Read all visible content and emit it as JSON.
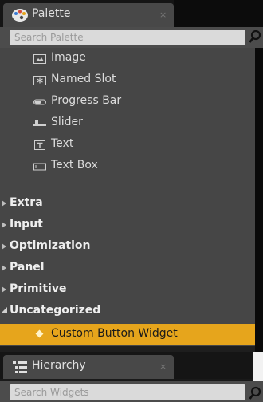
{
  "palette_tab": {
    "title": "Palette",
    "close_glyph": "×",
    "icon": "paint-palette-icon"
  },
  "palette_search": {
    "placeholder": "Search Palette"
  },
  "widgets": [
    {
      "label": "Image",
      "icon": "image-icon"
    },
    {
      "label": "Named Slot",
      "icon": "named-slot-icon"
    },
    {
      "label": "Progress Bar",
      "icon": "progress-bar-icon"
    },
    {
      "label": "Slider",
      "icon": "slider-icon"
    },
    {
      "label": "Text",
      "icon": "text-icon"
    },
    {
      "label": "Text Box",
      "icon": "text-box-icon"
    }
  ],
  "categories": [
    {
      "label": "Extra",
      "expanded": false
    },
    {
      "label": "Input",
      "expanded": false
    },
    {
      "label": "Optimization",
      "expanded": false
    },
    {
      "label": "Panel",
      "expanded": false
    },
    {
      "label": "Primitive",
      "expanded": false
    },
    {
      "label": "Uncategorized",
      "expanded": true
    }
  ],
  "selected_item": {
    "label": "Custom Button Widget"
  },
  "hierarchy_tab": {
    "title": "Hierarchy",
    "close_glyph": "×",
    "icon": "hierarchy-list-icon"
  },
  "hierarchy_search": {
    "placeholder": "Search Widgets"
  },
  "colors": {
    "selection": "#e6a51c",
    "panel": "#464646",
    "tab": "#484848"
  }
}
